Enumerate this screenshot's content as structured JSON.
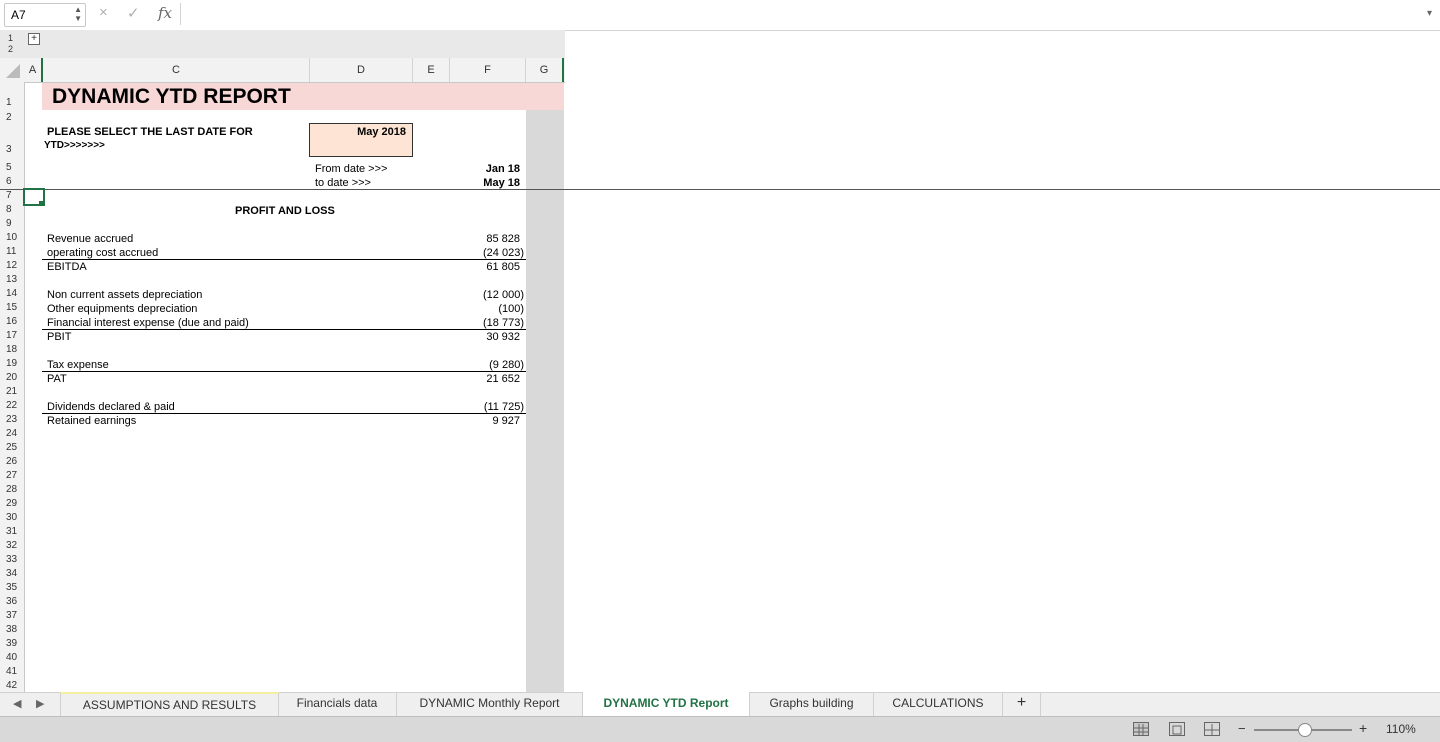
{
  "formula_bar": {
    "name_box": "A7",
    "spinner_icon": "spinner-icon",
    "cancel_icon": "×",
    "confirm_icon": "✓",
    "fx_label": "fx",
    "formula": "",
    "chevron": "▾"
  },
  "outline": {
    "levels": [
      "1",
      "2"
    ],
    "expand": "+"
  },
  "columns": [
    "A",
    "C",
    "D",
    "E",
    "F",
    "G"
  ],
  "rows": [
    "1",
    "2",
    "3",
    "5",
    "6",
    "7",
    "8",
    "9",
    "10",
    "11",
    "12",
    "13",
    "14",
    "15",
    "16",
    "17",
    "18",
    "19",
    "20",
    "21",
    "22",
    "23",
    "24",
    "25",
    "26",
    "27",
    "28",
    "29",
    "30",
    "31",
    "32",
    "33",
    "34",
    "35",
    "36",
    "37",
    "38",
    "39",
    "40",
    "41",
    "42"
  ],
  "sheet": {
    "title": "DYNAMIC YTD REPORT",
    "select_prompt_line1": "PLEASE SELECT THE LAST DATE FOR",
    "select_prompt_line2": "YTD>>>>>>>",
    "selected_date": "May 2018",
    "from_label": "From date >>>",
    "to_label": "to date >>>",
    "from_value": "Jan 18",
    "to_value": "May 18",
    "section_title": "PROFIT AND LOSS",
    "lines": [
      {
        "label": "Revenue accrued",
        "value": "85 828"
      },
      {
        "label": "operating cost accrued",
        "value": "(24 023)"
      },
      {
        "label": "EBITDA",
        "value": "61 805"
      },
      {
        "label": "Non current assets depreciation",
        "value": "(12 000)"
      },
      {
        "label": "Other equipments depreciation",
        "value": "(100)"
      },
      {
        "label": "Financial  interest expense (due and paid)",
        "value": "(18 773)"
      },
      {
        "label": "PBIT",
        "value": "30 932"
      },
      {
        "label": "Tax expense",
        "value": "(9 280)"
      },
      {
        "label": "PAT",
        "value": "21 652"
      },
      {
        "label": "Dividends declared & paid",
        "value": "(11 725)"
      },
      {
        "label": "Retained earnings",
        "value": "9 927"
      }
    ]
  },
  "tabs": {
    "items": [
      "ASSUMPTIONS AND RESULTS",
      "Financials data",
      "DYNAMIC Monthly Report",
      "DYNAMIC YTD Report",
      "Graphs building",
      "CALCULATIONS"
    ],
    "active": "DYNAMIC YTD Report",
    "add": "+",
    "prev": "◀",
    "next": "▶"
  },
  "status": {
    "zoom": "110%",
    "zoom_minus": "−",
    "zoom_plus": "+",
    "view_icons": [
      "normal-view-icon",
      "page-layout-icon",
      "page-break-icon"
    ]
  },
  "colors": {
    "accent": "#217346",
    "title_band": "#f8d7d7",
    "date_box": "#fde4d4",
    "gray_col": "#d9d9d9"
  }
}
